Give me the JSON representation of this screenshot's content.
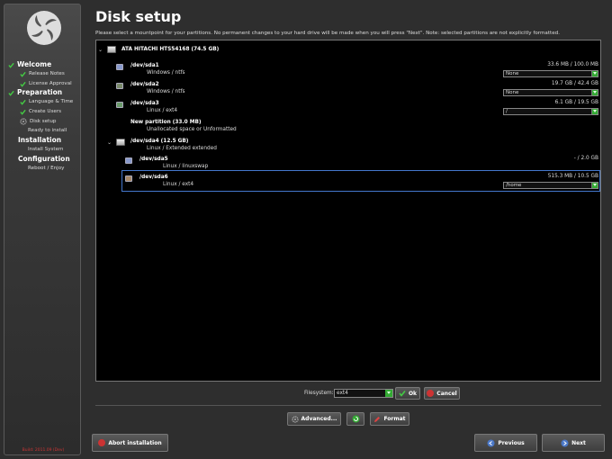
{
  "sidebar": {
    "groups": [
      {
        "label": "Welcome",
        "icon": "check-icon",
        "items": [
          {
            "label": "Release Notes",
            "icon": "check-icon"
          },
          {
            "label": "License Approval",
            "icon": "check-icon"
          }
        ]
      },
      {
        "label": "Preparation",
        "icon": "check-icon",
        "items": [
          {
            "label": "Language & Time",
            "icon": "check-icon"
          },
          {
            "label": "Create Users",
            "icon": "check-icon"
          },
          {
            "label": "Disk setup",
            "icon": "gear-icon"
          },
          {
            "label": "Ready to install",
            "icon": ""
          }
        ]
      },
      {
        "label": "Installation",
        "icon": "",
        "items": [
          {
            "label": "Install System",
            "icon": ""
          }
        ]
      },
      {
        "label": "Configuration",
        "icon": "",
        "items": [
          {
            "label": "Reboot / Enjoy",
            "icon": ""
          }
        ]
      }
    ],
    "build": "Build: 2011.09 (Dev)"
  },
  "header": {
    "title": "Disk setup",
    "subtitle": "Please select a mountpoint for your partitions. No permanent changes to your hard drive will be made when you will press \"Next\". Note: selected partitions are not explicitly formatted."
  },
  "disk": {
    "name": "ATA HITACHI HTS54168  (74.5 GB)",
    "partitions": [
      {
        "name": "/dev/sda1",
        "fs": "Windows / ntfs",
        "size": "33.6 MB / 100.0 MB",
        "mount": "None"
      },
      {
        "name": "/dev/sda2",
        "fs": "Windows / ntfs",
        "size": "19.7 GB / 42.4 GB",
        "mount": "None"
      },
      {
        "name": "/dev/sda3",
        "fs": "Linux / ext4",
        "size": "6.1 GB / 19.5 GB",
        "mount": "/"
      },
      {
        "name": "New partition  (33.0 MB)",
        "fs": "Unallocated space or Unformatted",
        "size": "",
        "mount": ""
      },
      {
        "name": "/dev/sda4  (12.5 GB)",
        "fs": "Linux / Extended extended",
        "size": "",
        "mount": ""
      },
      {
        "name": "/dev/sda5",
        "fs": "Linux / linuxswap",
        "size": "- / 2.0 GB",
        "mount": ""
      },
      {
        "name": "/dev/sda6",
        "fs": "Linux / ext4",
        "size": "515.3 MB / 10.5 GB",
        "mount": "/home"
      }
    ]
  },
  "filesystem": {
    "label": "Filesystem:",
    "value": "ext4"
  },
  "buttons": {
    "ok": "Ok",
    "cancel": "Cancel",
    "advanced": "Advanced...",
    "format": "Format",
    "abort": "Abort installation",
    "previous": "Previous",
    "next": "Next"
  },
  "colors": {
    "accent": "#3a9a3a",
    "selection": "#4477cc",
    "danger": "#cc3333"
  }
}
